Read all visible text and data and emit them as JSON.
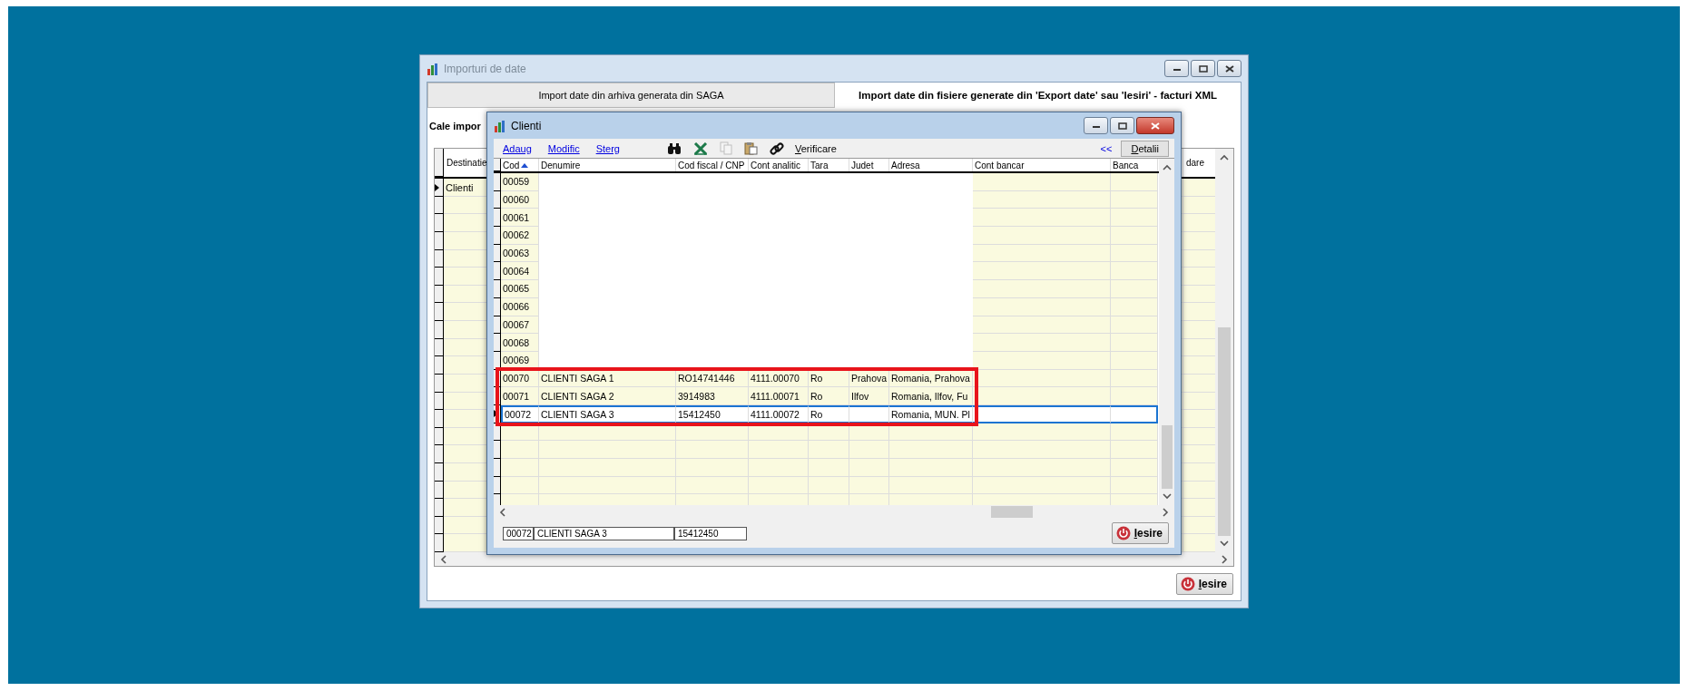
{
  "main_window": {
    "title": "Importuri de date",
    "active": false,
    "tabs": [
      {
        "label": "Import date din arhiva generata din SAGA",
        "selected": false
      },
      {
        "label": "Import date din fisiere generate din 'Export date' sau 'Iesiri' - facturi XML",
        "selected": true
      }
    ],
    "path_label": "Cale impor",
    "grid": {
      "columns": [
        "Destinatie",
        "dare"
      ],
      "rows": [
        {
          "destinatie": "Clienti",
          "current": true
        }
      ]
    },
    "exit_button": "Iesire"
  },
  "clienti_window": {
    "title": "Clienti",
    "active": true,
    "toolbar": {
      "actions": [
        "Adaug",
        "Modific",
        "Sterg"
      ],
      "tools": [
        {
          "kind": "find",
          "disabled": false
        },
        {
          "kind": "excel",
          "disabled": false
        },
        {
          "kind": "copy",
          "disabled": true
        },
        {
          "kind": "paste",
          "disabled": false
        },
        {
          "kind": "link",
          "disabled": false
        }
      ],
      "verify_button": "Verificare",
      "collapse_button": "<<",
      "details_button": "Detalii"
    },
    "table": {
      "columns": [
        {
          "label": "Cod",
          "sorted": true
        },
        {
          "label": "Denumire",
          "sorted": false
        },
        {
          "label": "Cod fiscal / CNP",
          "sorted": false
        },
        {
          "label": "Cont analitic",
          "sorted": false
        },
        {
          "label": "Tara",
          "sorted": false
        },
        {
          "label": "Judet",
          "sorted": false
        },
        {
          "label": "Adresa",
          "sorted": false
        },
        {
          "label": "Cont bancar",
          "sorted": false
        },
        {
          "label": "Banca",
          "sorted": false
        }
      ],
      "rows": [
        {
          "cod": "00059",
          "selected": false,
          "highlighted": false
        },
        {
          "cod": "00060",
          "selected": false,
          "highlighted": false
        },
        {
          "cod": "00061",
          "selected": false,
          "highlighted": false
        },
        {
          "cod": "00062",
          "selected": false,
          "highlighted": false
        },
        {
          "cod": "00063",
          "selected": false,
          "highlighted": false
        },
        {
          "cod": "00064",
          "selected": false,
          "highlighted": false
        },
        {
          "cod": "00065",
          "selected": false,
          "highlighted": false
        },
        {
          "cod": "00066",
          "selected": false,
          "highlighted": false
        },
        {
          "cod": "00067",
          "selected": false,
          "highlighted": false
        },
        {
          "cod": "00068",
          "selected": false,
          "highlighted": false
        },
        {
          "cod": "00069",
          "selected": false,
          "highlighted": false
        },
        {
          "cod": "00070",
          "denumire": "CLIENTI SAGA 1",
          "cod_fiscal": "RO14741446",
          "cont_analitic": "4111.00070",
          "tara": "Ro",
          "judet": "Prahova",
          "adresa": "Romania, Prahova",
          "selected": false,
          "highlighted": true
        },
        {
          "cod": "00071",
          "denumire": "CLIENTI SAGA 2",
          "cod_fiscal": "3914983",
          "cont_analitic": "4111.00071",
          "tara": "Ro",
          "judet": "Ilfov",
          "adresa": "Romania, Ilfov, Fu",
          "selected": false,
          "highlighted": true
        },
        {
          "cod": "00072",
          "denumire": "CLIENTI SAGA 3",
          "cod_fiscal": "15412450",
          "cont_analitic": "4111.00072",
          "tara": "Ro",
          "adresa": "Romania, MUN. Pl",
          "selected": true,
          "highlighted": true
        }
      ]
    },
    "footer_fields": [
      "00072",
      "CLIENTI SAGA 3",
      "15412450"
    ],
    "exit_button": "Iesire"
  }
}
